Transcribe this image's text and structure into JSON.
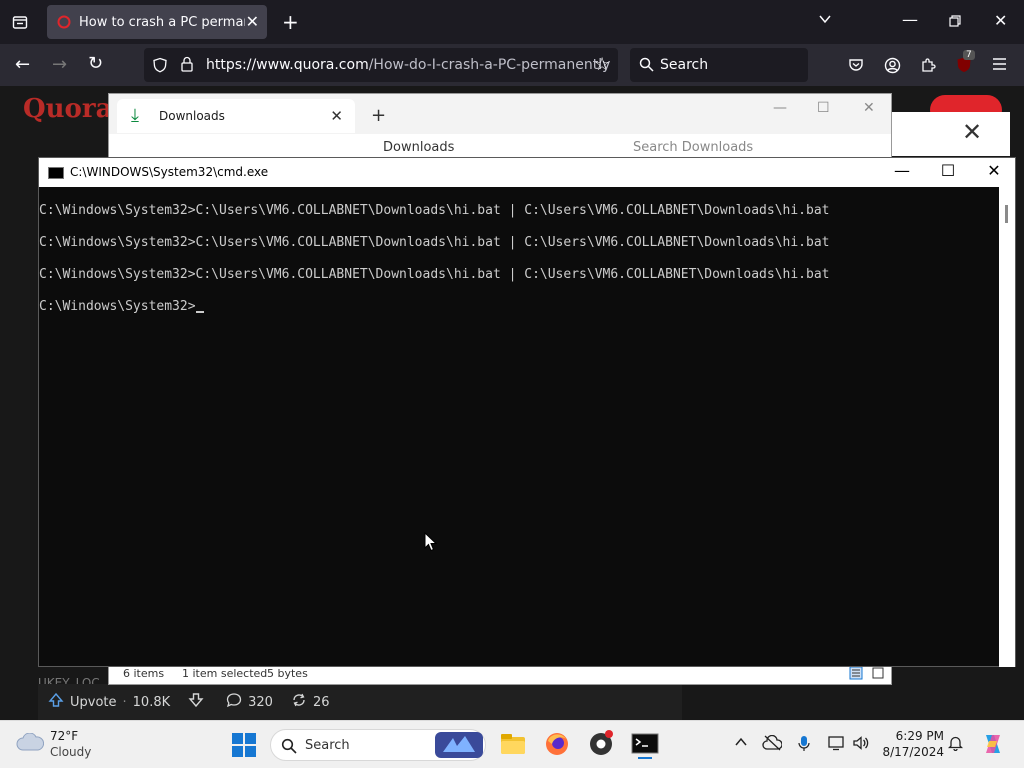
{
  "browser": {
    "tab_title": "How to crash a PC permanently",
    "url_domain": "https://www.quora.com",
    "url_path": "/How-do-I-crash-a-PC-permanently",
    "search_placeholder": "Search",
    "extension_badge": "7"
  },
  "quora": {
    "logo": "Quora",
    "upvote_label": "Upvote",
    "upvote_count": "10.8K",
    "comment_count": "320",
    "share_count": "26",
    "partial_text": "UKEY_LOC"
  },
  "downloads": {
    "tab_title": "Downloads",
    "breadcrumb": "Downloads",
    "search_placeholder": "Search Downloads",
    "status_items": "6 items",
    "status_selected": "1 item selected",
    "status_size": "5 bytes"
  },
  "cmd": {
    "title": "C:\\WINDOWS\\System32\\cmd.exe",
    "lines": [
      "C:\\Windows\\System32>C:\\Users\\VM6.COLLABNET\\Downloads\\hi.bat | C:\\Users\\VM6.COLLABNET\\Downloads\\hi.bat",
      "C:\\Windows\\System32>C:\\Users\\VM6.COLLABNET\\Downloads\\hi.bat | C:\\Users\\VM6.COLLABNET\\Downloads\\hi.bat",
      "C:\\Windows\\System32>C:\\Users\\VM6.COLLABNET\\Downloads\\hi.bat | C:\\Users\\VM6.COLLABNET\\Downloads\\hi.bat"
    ],
    "prompt": "C:\\Windows\\System32>"
  },
  "taskbar": {
    "weather_temp": "72°F",
    "weather_condition": "Cloudy",
    "search_label": "Search",
    "time": "6:29 PM",
    "date": "8/17/2024"
  },
  "colors": {
    "quora_red": "#b92b27",
    "cmd_bg": "#0c0c0c",
    "cmd_text": "#cccccc",
    "windows_blue": "#1677d2"
  }
}
